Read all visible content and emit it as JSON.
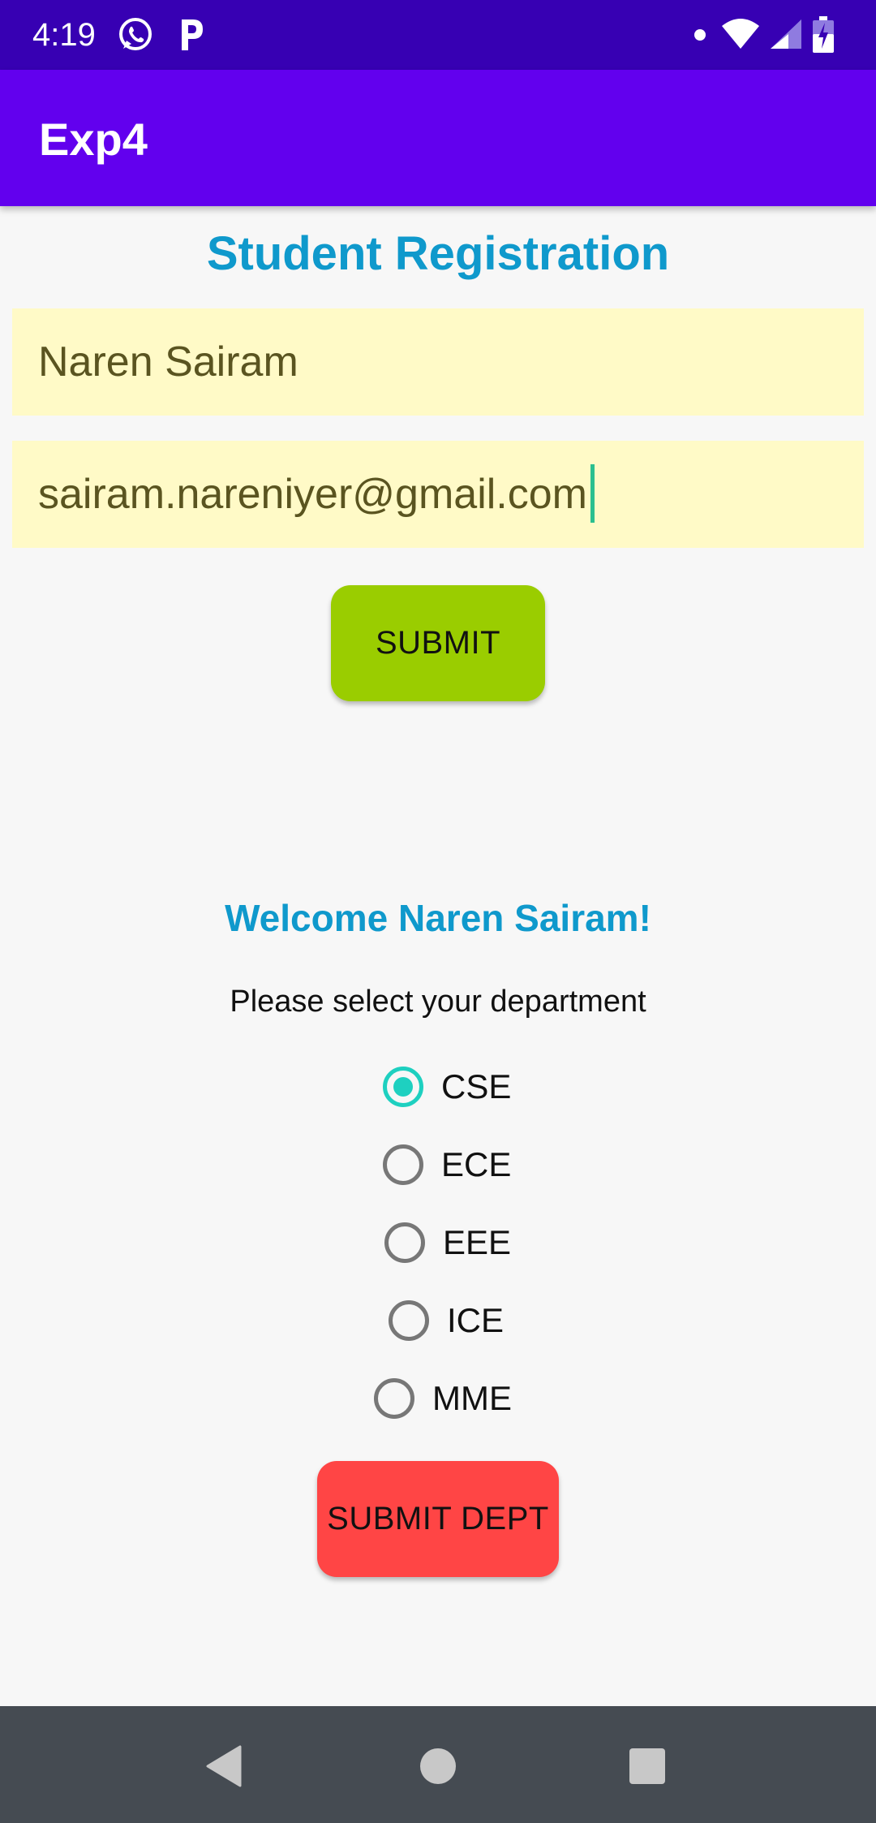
{
  "status_bar": {
    "time": "4:19"
  },
  "app_bar": {
    "title": "Exp4"
  },
  "form": {
    "title": "Student Registration",
    "name_value": "Naren Sairam",
    "email_value": "sairam.nareniyer@gmail.com",
    "submit_label": "SUBMIT"
  },
  "department": {
    "welcome": "Welcome Naren Sairam!",
    "prompt": "Please select your department",
    "options": [
      {
        "label": "CSE",
        "checked": true
      },
      {
        "label": "ECE",
        "checked": false
      },
      {
        "label": "EEE",
        "checked": false
      },
      {
        "label": "ICE",
        "checked": false
      },
      {
        "label": "MME",
        "checked": false
      }
    ],
    "submit_label": "SUBMIT DEPT"
  },
  "colors": {
    "status_bar": "#3700b3",
    "app_bar": "#6200ee",
    "title_text": "#0f99cc",
    "field_bg": "#fffac7",
    "submit_button": "#9acd00",
    "dept_button": "#ff4545",
    "radio_checked": "#1ed0c0",
    "nav_bar": "#454b52"
  },
  "icons": [
    "whatsapp-icon",
    "p-icon",
    "dot-icon",
    "wifi-icon",
    "signal-icon",
    "battery-icon",
    "back-icon",
    "home-icon",
    "recent-apps-icon"
  ]
}
